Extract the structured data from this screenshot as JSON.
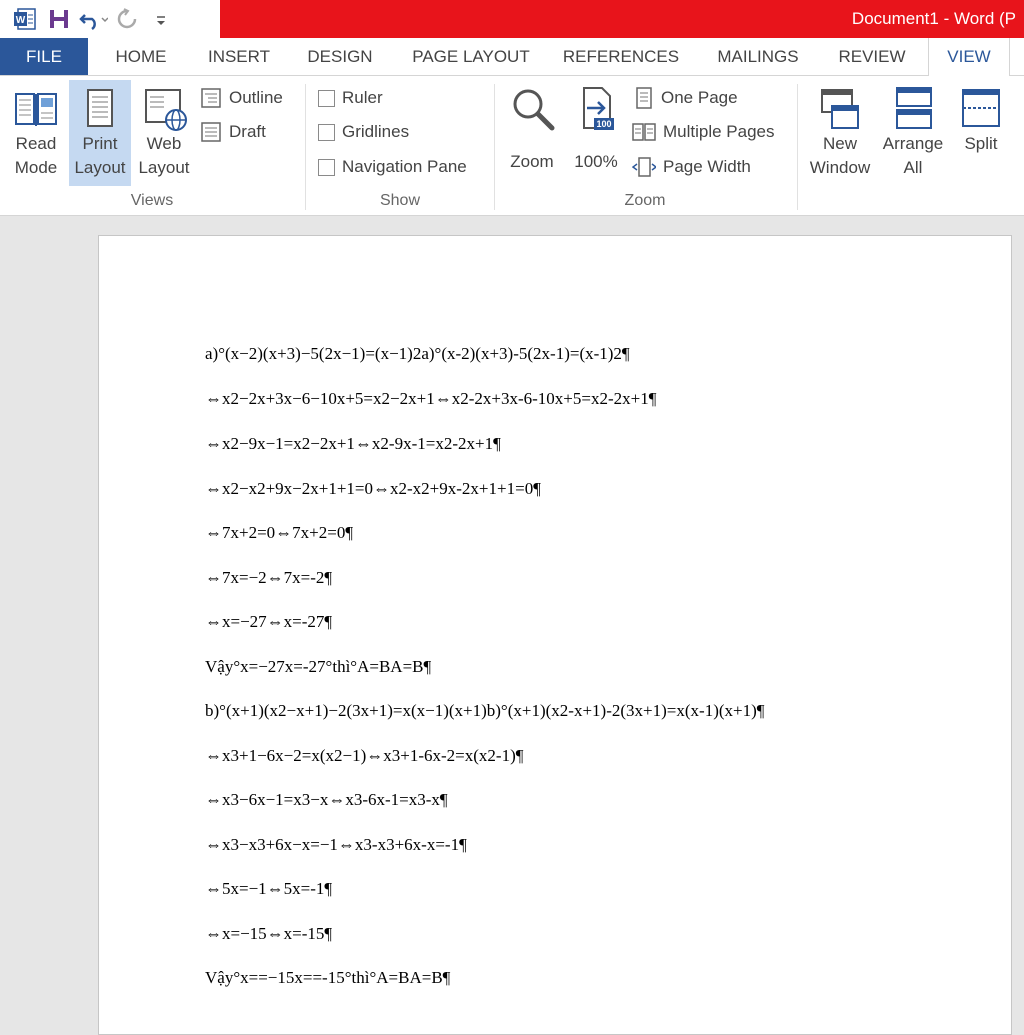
{
  "window": {
    "title": "Document1 - Word (P"
  },
  "colors": {
    "accent": "#2b579a",
    "title_red": "#e8141b"
  },
  "quick_access": [
    "word-app-icon",
    "save-icon",
    "undo-icon",
    "redo-icon",
    "customize-icon"
  ],
  "tabs": [
    {
      "label": "FILE"
    },
    {
      "label": "HOME"
    },
    {
      "label": "INSERT"
    },
    {
      "label": "DESIGN"
    },
    {
      "label": "PAGE LAYOUT"
    },
    {
      "label": "REFERENCES"
    },
    {
      "label": "MAILINGS"
    },
    {
      "label": "REVIEW"
    },
    {
      "label": "VIEW",
      "active": true
    }
  ],
  "ribbon": {
    "views": {
      "group_label": "Views",
      "read_mode": [
        "Read",
        "Mode"
      ],
      "print_layout": [
        "Print",
        "Layout"
      ],
      "web_layout": [
        "Web",
        "Layout"
      ],
      "outline": "Outline",
      "draft": "Draft"
    },
    "show": {
      "group_label": "Show",
      "ruler": "Ruler",
      "gridlines": "Gridlines",
      "navigation_pane": "Navigation Pane"
    },
    "zoom": {
      "group_label": "Zoom",
      "zoom": "Zoom",
      "hundred": "100%",
      "hundred_badge": "100",
      "one_page": "One Page",
      "multiple_pages": "Multiple Pages",
      "page_width": "Page Width"
    },
    "window": {
      "new_window": [
        "New",
        "Window"
      ],
      "arrange_all": [
        "Arrange",
        "All"
      ],
      "split": "Split"
    }
  },
  "document": {
    "lines": [
      "a)°(x−2)(x+3)−5(2x−1)=(x−1)2a)°(x-2)(x+3)-5(2x-1)=(x-1)2¶",
      "⇔x2−2x+3x−6−10x+5=x2−2x+1⇔x2-2x+3x-6-10x+5=x2-2x+1¶",
      "⇔x2−9x−1=x2−2x+1⇔x2-9x-1=x2-2x+1¶",
      "⇔x2−x2+9x−2x+1+1=0⇔x2-x2+9x-2x+1+1=0¶",
      "⇔7x+2=0⇔7x+2=0¶",
      "⇔7x=−2⇔7x=-2¶",
      "⇔x=−27⇔x=-27¶",
      "Vậy°x=−27x=-27°thì°A=BA=B¶",
      "b)°(x+1)(x2−x+1)−2(3x+1)=x(x−1)(x+1)b)°(x+1)(x2-x+1)-2(3x+1)=x(x-1)(x+1)¶",
      "⇔x3+1−6x−2=x(x2−1)⇔x3+1-6x-2=x(x2-1)¶",
      "⇔x3−6x−1=x3−x⇔x3-6x-1=x3-x¶",
      "⇔x3−x3+6x−x=−1⇔x3-x3+6x-x=-1¶",
      "⇔5x=−1⇔5x=-1¶",
      "⇔x=−15⇔x=-15¶",
      "Vậy°x==−15x==-15°thì°A=BA=B¶"
    ]
  }
}
